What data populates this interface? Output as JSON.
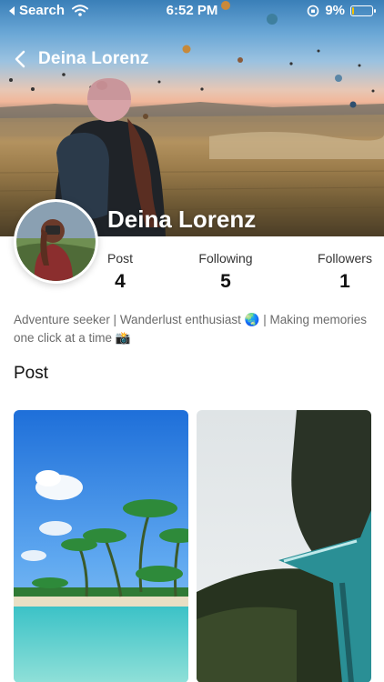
{
  "status_bar": {
    "back_app": "Search",
    "time": "6:52 PM",
    "battery": "9%",
    "battery_level": 0.09
  },
  "nav": {
    "title": "Deina Lorenz"
  },
  "profile": {
    "name": "Deina Lorenz",
    "bio": "Adventure seeker | Wanderlust enthusiast 🌏  | Making memories one click at a time 📸"
  },
  "stats": [
    {
      "label": "Post",
      "value": "4"
    },
    {
      "label": "Following",
      "value": "5"
    },
    {
      "label": "Followers",
      "value": "1"
    }
  ],
  "posts_section": {
    "title": "Post"
  },
  "colors": {
    "accent_battery": "#f2c200",
    "text_muted": "#6b6b6b"
  },
  "icons": [
    "back-chevron-icon",
    "wifi-icon",
    "rotation-lock-icon",
    "battery-icon"
  ]
}
